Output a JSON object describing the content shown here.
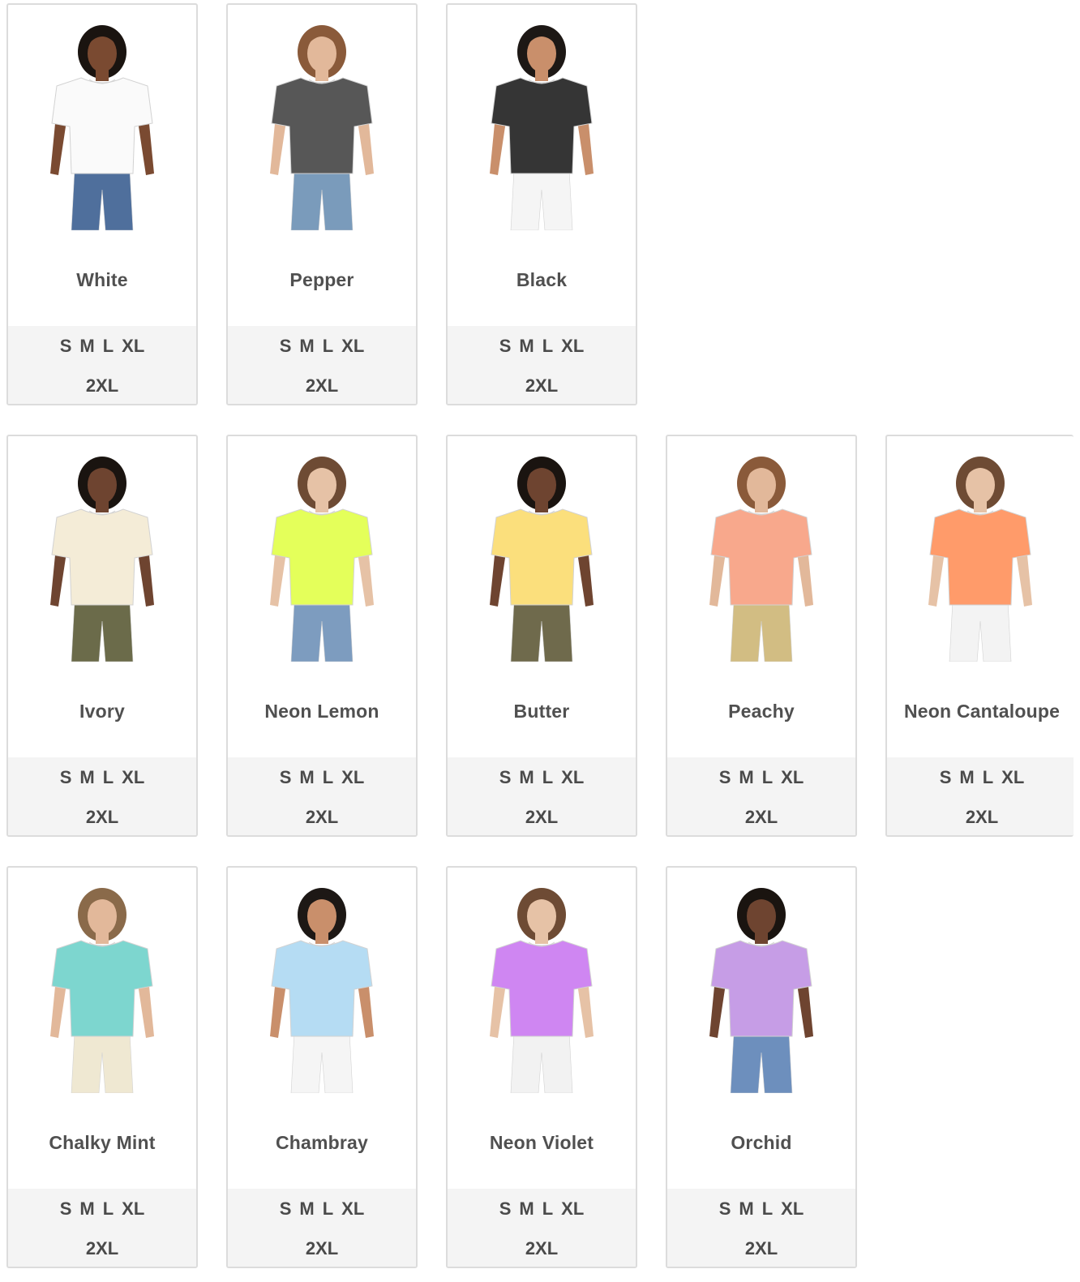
{
  "products": [
    {
      "name": "White",
      "shirt": "#fafafa",
      "pants": "#4f6f9c",
      "skin": "#7a4a31",
      "hair": "#1a1410",
      "sizes_row1": [
        "S",
        "M",
        "L",
        "XL"
      ],
      "sizes_row2": [
        "2XL"
      ]
    },
    {
      "name": "Pepper",
      "shirt": "#575757",
      "pants": "#7a9bbb",
      "skin": "#e2b89a",
      "hair": "#8a5a3a",
      "sizes_row1": [
        "S",
        "M",
        "L",
        "XL"
      ],
      "sizes_row2": [
        "2XL"
      ]
    },
    {
      "name": "Black",
      "shirt": "#353535",
      "pants": "#f5f5f5",
      "skin": "#c98f6b",
      "hair": "#1d1815",
      "sizes_row1": [
        "S",
        "M",
        "L",
        "XL"
      ],
      "sizes_row2": [
        "2XL"
      ]
    },
    {
      "name": "Ivory",
      "shirt": "#f4ecd7",
      "pants": "#6b6b4a",
      "skin": "#6e4430",
      "hair": "#1a1410",
      "sizes_row1": [
        "S",
        "M",
        "L",
        "XL"
      ],
      "sizes_row2": [
        "2XL"
      ]
    },
    {
      "name": "Neon Lemon",
      "shirt": "#e4ff5a",
      "pants": "#7d9cbf",
      "skin": "#e6c2a6",
      "hair": "#6e4b34",
      "sizes_row1": [
        "S",
        "M",
        "L",
        "XL"
      ],
      "sizes_row2": [
        "2XL"
      ]
    },
    {
      "name": "Butter",
      "shirt": "#fbdf7c",
      "pants": "#6f6a4c",
      "skin": "#6e4430",
      "hair": "#1a1410",
      "sizes_row1": [
        "S",
        "M",
        "L",
        "XL"
      ],
      "sizes_row2": [
        "2XL"
      ]
    },
    {
      "name": "Peachy",
      "shirt": "#f8a88c",
      "pants": "#d2bd83",
      "skin": "#e2b89a",
      "hair": "#8a5a3a",
      "sizes_row1": [
        "S",
        "M",
        "L",
        "XL"
      ],
      "sizes_row2": [
        "2XL"
      ]
    },
    {
      "name": "Neon Cantaloupe",
      "shirt": "#ff9b6a",
      "pants": "#f3f3f3",
      "skin": "#e6c2a6",
      "hair": "#6e4b34",
      "sizes_row1": [
        "S",
        "M",
        "L",
        "XL"
      ],
      "sizes_row2": [
        "2XL"
      ]
    },
    {
      "name": "Chalky Mint",
      "shirt": "#7dd6cf",
      "pants": "#efe8d2",
      "skin": "#e2b89a",
      "hair": "#8a6a4a",
      "sizes_row1": [
        "S",
        "M",
        "L",
        "XL"
      ],
      "sizes_row2": [
        "2XL"
      ]
    },
    {
      "name": "Chambray",
      "shirt": "#b5dcf3",
      "pants": "#f5f5f5",
      "skin": "#c98f6b",
      "hair": "#1d1815",
      "sizes_row1": [
        "S",
        "M",
        "L",
        "XL"
      ],
      "sizes_row2": [
        "2XL"
      ]
    },
    {
      "name": "Neon Violet",
      "shirt": "#cf86f2",
      "pants": "#f2f2f2",
      "skin": "#e6c2a6",
      "hair": "#6e4b34",
      "sizes_row1": [
        "S",
        "M",
        "L",
        "XL"
      ],
      "sizes_row2": [
        "2XL"
      ]
    },
    {
      "name": "Orchid",
      "shirt": "#c69de6",
      "pants": "#6d8fbd",
      "skin": "#6e4430",
      "hair": "#1a1410",
      "sizes_row1": [
        "S",
        "M",
        "L",
        "XL"
      ],
      "sizes_row2": [
        "2XL"
      ]
    }
  ]
}
